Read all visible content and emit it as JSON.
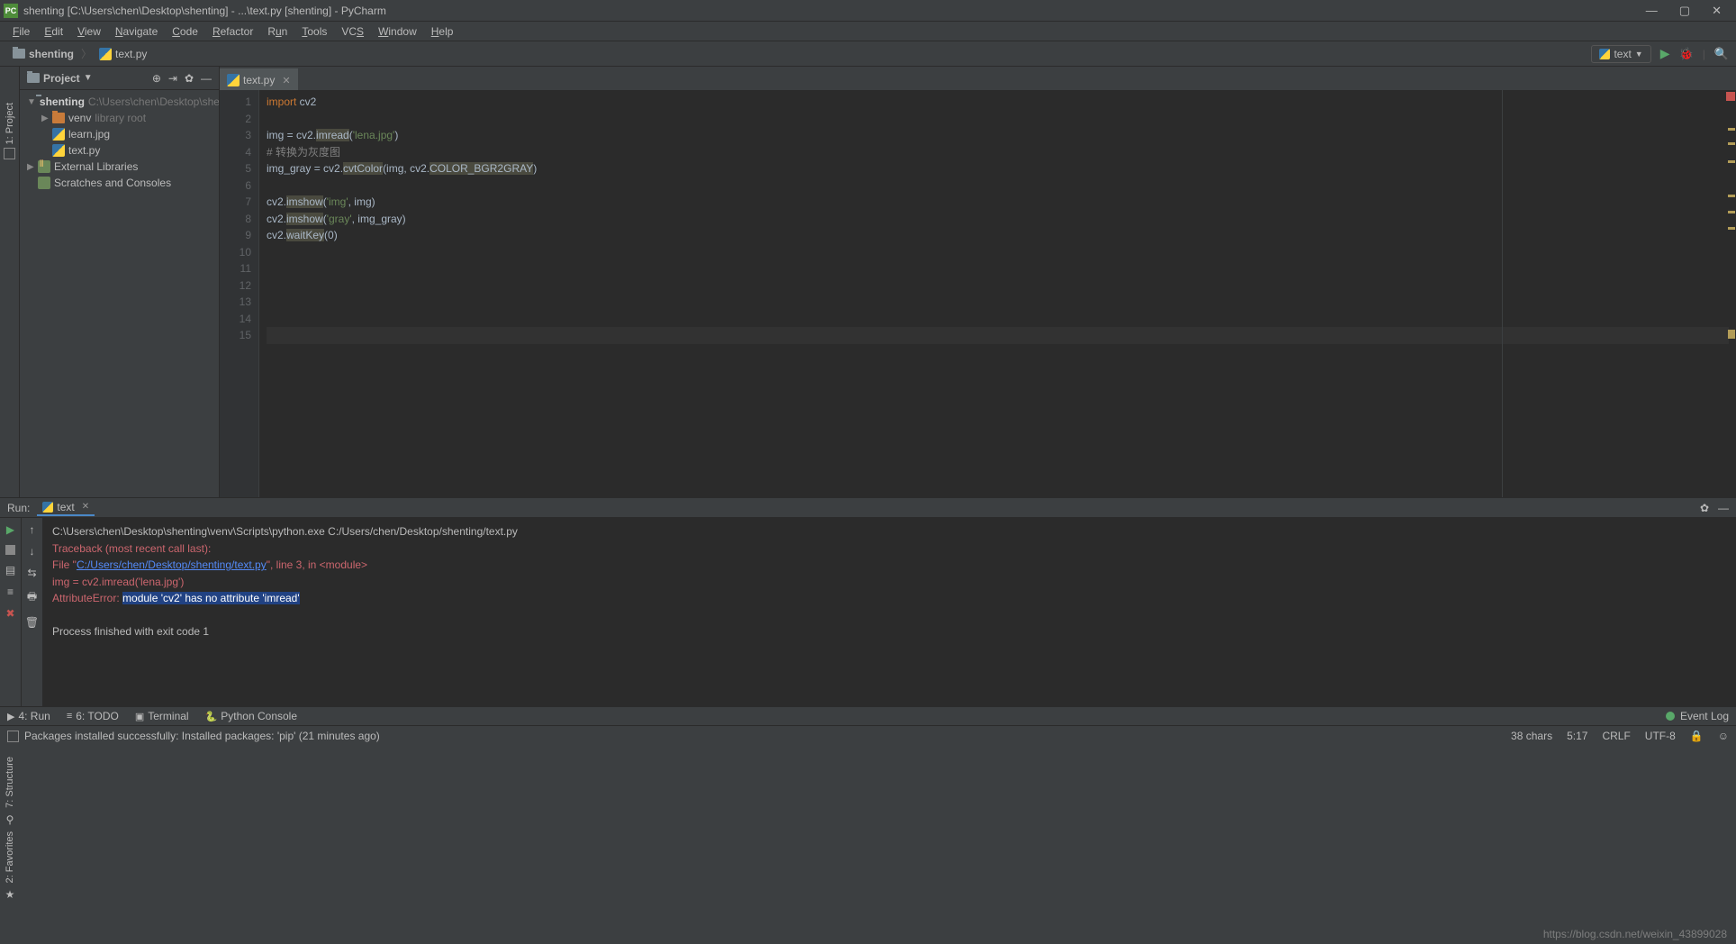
{
  "title": "shenting [C:\\Users\\chen\\Desktop\\shenting] - ...\\text.py [shenting] - PyCharm",
  "menu": [
    "File",
    "Edit",
    "View",
    "Navigate",
    "Code",
    "Refactor",
    "Run",
    "Tools",
    "VCS",
    "Window",
    "Help"
  ],
  "breadcrumb": {
    "root": "shenting",
    "file": "text.py"
  },
  "runConfig": "text",
  "projectPanel": {
    "title": "Project",
    "root": {
      "name": "shenting",
      "path": "C:\\Users\\chen\\Desktop\\shenting"
    },
    "venv": {
      "name": "venv",
      "note": "library root"
    },
    "files": [
      "learn.jpg",
      "text.py"
    ],
    "extLib": "External Libraries",
    "scratches": "Scratches and Consoles"
  },
  "editorTab": "text.py",
  "codeLines": [
    [
      {
        "t": "import",
        "c": "kw"
      },
      {
        "t": " cv2"
      }
    ],
    [
      {
        "t": ""
      }
    ],
    [
      {
        "t": "img = cv2."
      },
      {
        "t": "imread",
        "c": "hi"
      },
      {
        "t": "("
      },
      {
        "t": "'lena.jpg'",
        "c": "str"
      },
      {
        "t": ")"
      }
    ],
    [
      {
        "t": "# 转换为灰度图",
        "c": "cmt"
      }
    ],
    [
      {
        "t": "img_gray = cv2."
      },
      {
        "t": "cvtColor",
        "c": "hi"
      },
      {
        "t": "(img, cv2."
      },
      {
        "t": "COLOR_BGR2GRAY",
        "c": "hi"
      },
      {
        "t": ")"
      }
    ],
    [
      {
        "t": ""
      }
    ],
    [
      {
        "t": "cv2."
      },
      {
        "t": "imshow",
        "c": "hi"
      },
      {
        "t": "("
      },
      {
        "t": "'img'",
        "c": "str"
      },
      {
        "t": ", img)"
      }
    ],
    [
      {
        "t": "cv2."
      },
      {
        "t": "imshow",
        "c": "hi"
      },
      {
        "t": "("
      },
      {
        "t": "'gray'",
        "c": "str"
      },
      {
        "t": ", img_gray)"
      }
    ],
    [
      {
        "t": "cv2."
      },
      {
        "t": "waitKey",
        "c": "hi"
      },
      {
        "t": "("
      },
      {
        "t": "0",
        "c": ""
      },
      {
        "t": ")"
      }
    ],
    [
      {
        "t": ""
      }
    ],
    [
      {
        "t": ""
      }
    ],
    [
      {
        "t": ""
      }
    ],
    [
      {
        "t": ""
      }
    ],
    [
      {
        "t": ""
      }
    ],
    [
      {
        "t": ""
      }
    ]
  ],
  "lineCount": 15,
  "currentLine": 15,
  "runPanel": {
    "label": "Run:",
    "config": "text",
    "cmd": "C:\\Users\\chen\\Desktop\\shenting\\venv\\Scripts\\python.exe C:/Users/chen/Desktop/shenting/text.py",
    "trace": "Traceback (most recent call last):",
    "file_prefix": "  File \"",
    "file_link": "C:/Users/chen/Desktop/shenting/text.py",
    "file_suffix": "\", line 3, in <module>",
    "errline": "    img = cv2.imread('lena.jpg')",
    "attrerr_prefix": "AttributeError: ",
    "attrerr_sel": "module 'cv2' has no attribute 'imread'",
    "exit": "Process finished with exit code 1"
  },
  "sideTabs": {
    "project": "1: Project",
    "structure": "7: Structure",
    "favorites": "2: Favorites"
  },
  "bottomTabs": {
    "run": "4: Run",
    "todo": "6: TODO",
    "terminal": "Terminal",
    "python": "Python Console",
    "eventlog": "Event Log"
  },
  "statusMsg": "Packages installed successfully: Installed packages: 'pip' (21 minutes ago)",
  "statusRight": {
    "chars": "38 chars",
    "pos": "5:17",
    "crlf": "CRLF",
    "enc": "UTF-8"
  },
  "watermark": "https://blog.csdn.net/weixin_43899028"
}
